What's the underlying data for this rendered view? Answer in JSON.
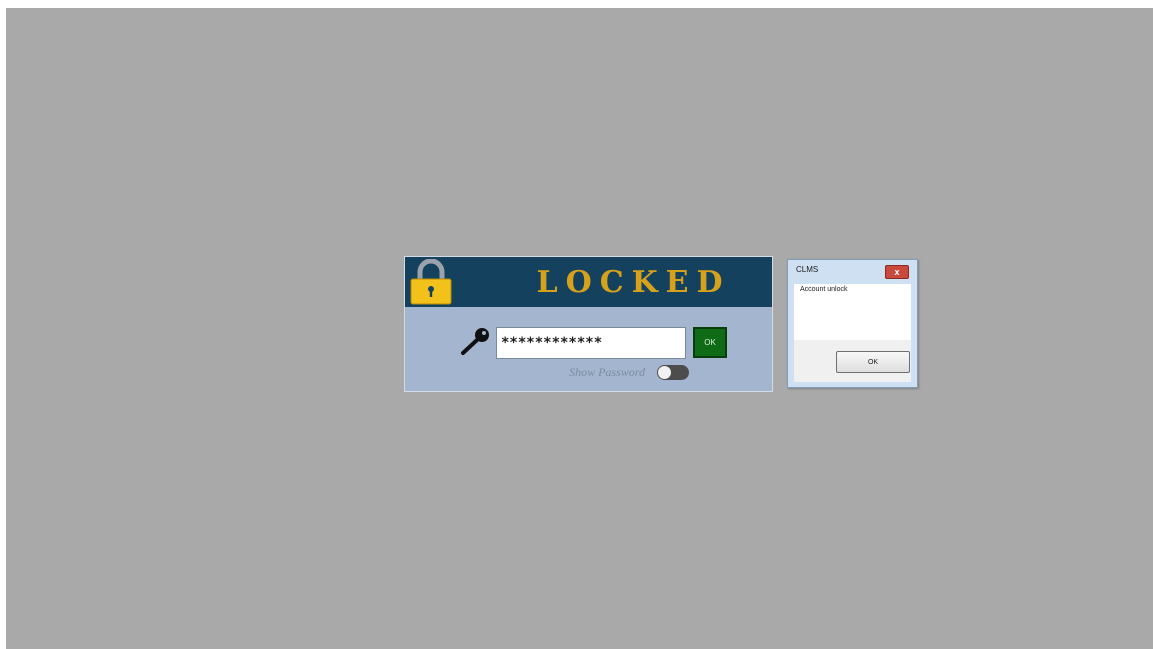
{
  "lock_screen": {
    "title": "LOCKED",
    "password_value": "************",
    "ok_label": "OK",
    "show_password_label": "Show Password",
    "show_password_enabled": false,
    "icons": {
      "padlock": "padlock-icon",
      "key": "key-icon"
    },
    "colors": {
      "header_bg": "#14415e",
      "title_color": "#d7a21b",
      "panel_bg": "#a4b6cf",
      "ok_button_bg": "#0f6b15"
    }
  },
  "message_box": {
    "title": "CLMS",
    "message": "Account unlock",
    "ok_label": "OK",
    "close_label": "x",
    "icons": {
      "close": "close-icon"
    }
  },
  "desktop": {
    "background_color": "#a9a9a9"
  }
}
